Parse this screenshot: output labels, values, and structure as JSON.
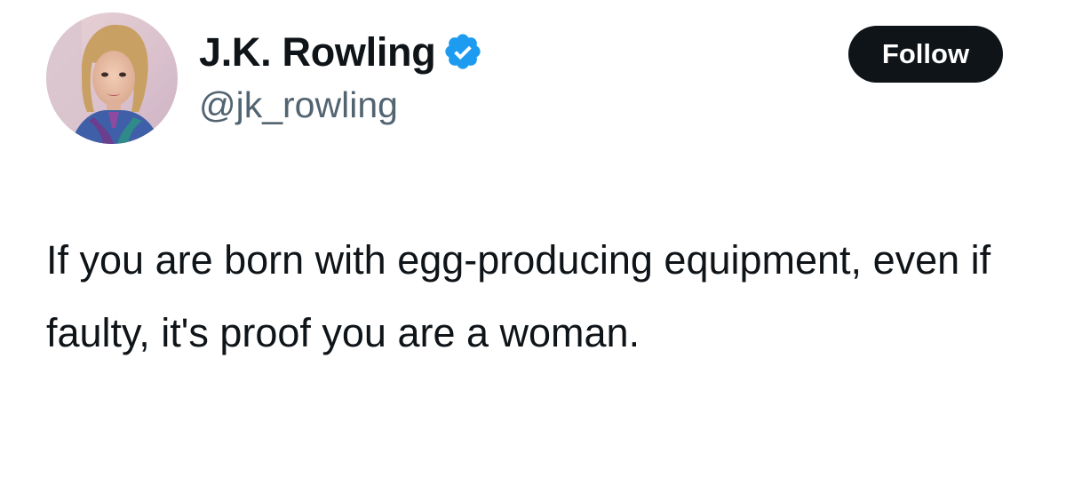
{
  "tweet": {
    "author": {
      "display_name": "J.K. Rowling",
      "handle": "@jk_rowling",
      "verified": true,
      "avatar_icon": "avatar-photo"
    },
    "follow_label": "Follow",
    "text": "If you are born with egg-producing equipment, even if faulty, it's proof you are a woman."
  },
  "colors": {
    "background": "#ffffff",
    "text_primary": "#0f1419",
    "text_secondary": "#536471",
    "verified_badge": "#1d9bf0",
    "follow_button_bg": "#0f1419",
    "follow_button_text": "#ffffff"
  }
}
